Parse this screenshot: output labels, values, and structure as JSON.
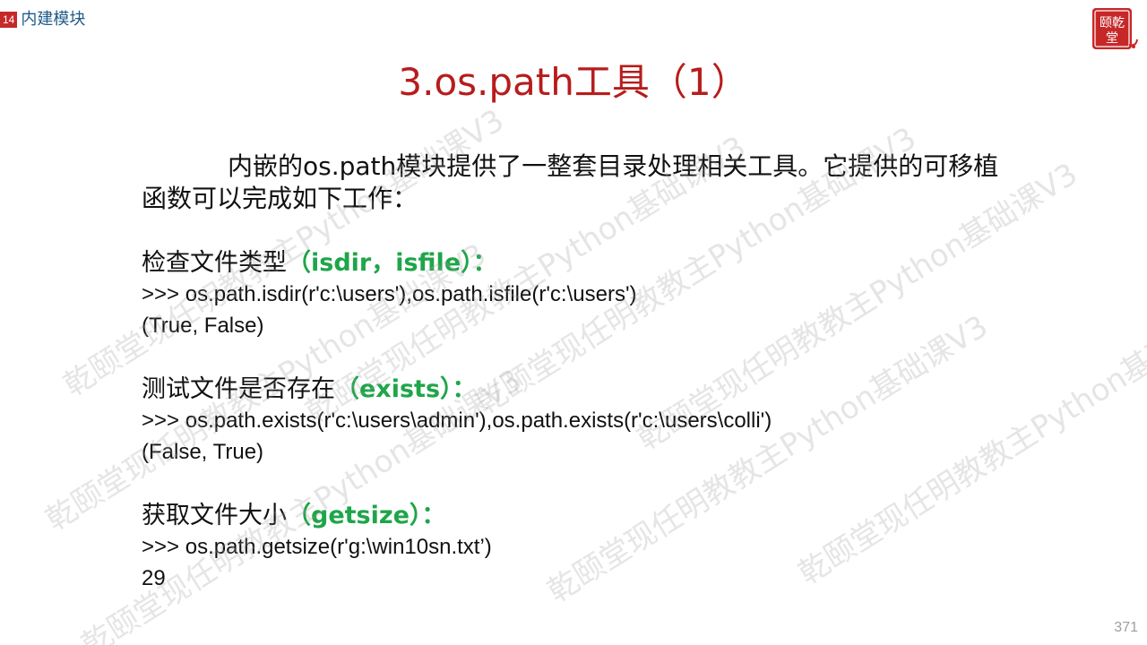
{
  "header": {
    "chapter_number": "14",
    "chapter_title": "内建模块"
  },
  "slide": {
    "title": "3.os.path工具（1）",
    "intro": "内嵌的os.path模块提供了一整套目录处理相关工具。它提供的可移植函数可以完成如下工作：",
    "sections": [
      {
        "heading": "检查文件类型",
        "func": "（isdir，isfile）：",
        "code": ">>> os.path.isdir(r'c:\\users'),os.path.isfile(r'c:\\users')",
        "result": "(True, False)"
      },
      {
        "heading": "测试文件是否存在",
        "func": "（exists）：",
        "code": ">>> os.path.exists(r'c:\\users\\admin'),os.path.exists(r'c:\\users\\colli')",
        "result": "(False, True)"
      },
      {
        "heading": "获取文件大小",
        "func": "（getsize）：",
        "code": ">>> os.path.getsize(r'g:\\win10sn.txt’)",
        "result": "29"
      }
    ],
    "page_number": "371"
  },
  "watermark": {
    "text": "乾颐堂现任明教教主Python基础课V3"
  },
  "logo": {
    "text": "乾颐堂"
  },
  "colors": {
    "title": "#b71c1c",
    "function_highlight": "#1fa54a",
    "chapter_badge": "#c62828",
    "chapter_text": "#1f5a8a"
  }
}
